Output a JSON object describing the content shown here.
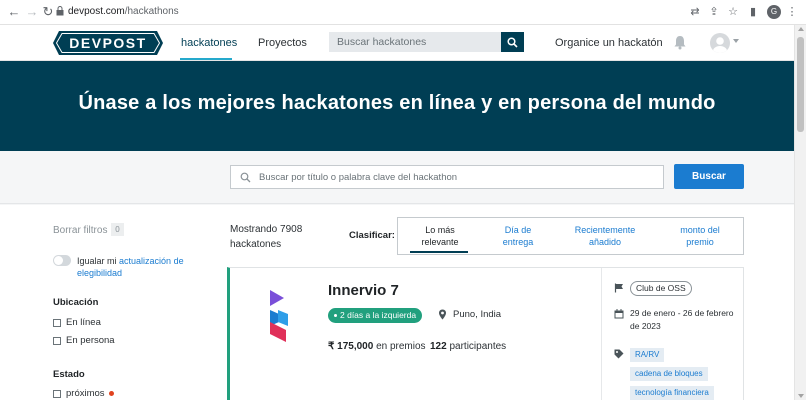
{
  "browser": {
    "url_host": "devpost.com",
    "url_path": "/hackathons",
    "profile_initial": "G"
  },
  "header": {
    "logo_text": "DEVPOST",
    "nav": [
      "hackatones",
      "Proyectos"
    ],
    "search_placeholder": "Buscar hackatones",
    "organize": "Organice un hackatón"
  },
  "hero": {
    "title": "Únase a los mejores hackatones en línea y en persona del mundo"
  },
  "search": {
    "placeholder": "Buscar por título o palabra clave del hackathon",
    "button": "Buscar"
  },
  "sidebar": {
    "clear_filters": "Borrar filtros",
    "clear_count": "0",
    "match_text": "Igualar mi",
    "match_link": "actualización de elegibilidad",
    "location_title": "Ubicación",
    "location_options": [
      "En línea",
      "En persona"
    ],
    "status_title": "Estado",
    "status_options": [
      "próximos"
    ]
  },
  "results": {
    "showing": "Mostrando 7908 hackatones",
    "sort_label": "Clasificar:",
    "sort_tabs": [
      "Lo más relevante",
      "Día de entrega",
      "Recientemente añadido",
      "monto del premio"
    ]
  },
  "card": {
    "title": "Innervio 7",
    "days_left": "2 días a la izquierda",
    "location": "Puno, India",
    "prize_amount": "₹ 175,000",
    "prize_suffix": "en premios",
    "participants_count": "122",
    "participants_suffix": "participantes",
    "host": "Club de OSS",
    "dates": "29 de enero - 26 de febrero de 2023",
    "tags": [
      "RA/RV",
      "cadena de bloques",
      "tecnología financiera"
    ]
  },
  "colors": {
    "brand_dark": "#003e54",
    "accent_blue": "#1b7cd0",
    "green": "#21a07e"
  }
}
